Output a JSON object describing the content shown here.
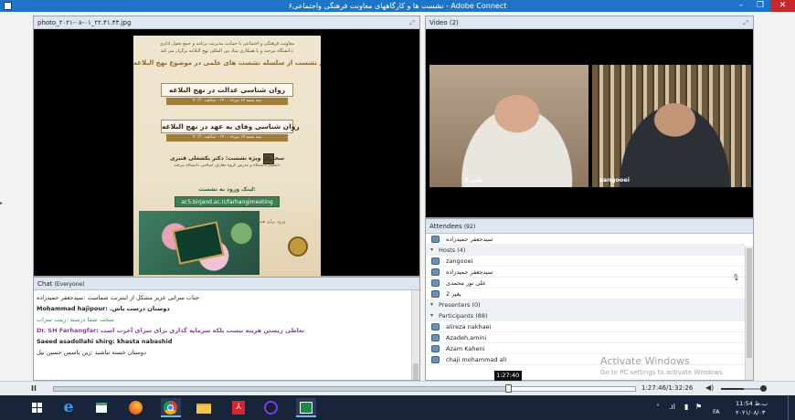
{
  "window": {
    "title": "نشست ها و کارگاههای معاونت فرهنگی واجتماعی۶ - Adobe Connect",
    "controls": {
      "minimize": "–",
      "restore": "❐",
      "close": "✕"
    }
  },
  "photo_pod": {
    "title": "photo_۲۰۲۱-۰۸-۰۱_۲۲.۴۱.۴۳.jpg",
    "poster": {
      "header_1": "معاونت فرهنگی و اجتماعی با حمایت مدیریت برنامه و جمع تحول اداری",
      "header_2": "دانشگاه بیرجند و با همکاری بنیاد بین المللی نهج البلاغه برگزار می کند:",
      "series": "دومین نشست از سلسله نشست های علمی در موضوع نهج البلاغه",
      "talk_1": "روان شناسی عدالت در نهج البلاغه",
      "talk_1_when": "سه شنبه ۱۲ مرداد ۱۴۰۰ - ساعت ۲۰:۳۰",
      "talk_2": "روان شناسی وفای به عهد در نهج البلاغه",
      "talk_2_when": "سه شنبه ۱۹ مرداد ۱۴۰۰ - ساعت ۲۰:۳۰",
      "speaker": "سخنران ویژه نشست: دکتر یکشعلی قنبری",
      "speaker_sub": "دانشیار دانشگاه و مدرس گروه معارف اسلامی دانشگاه بیرجند",
      "link_label": "لینک ورود به نشست:",
      "link": "ac5.birjand.ac.ir/farhangimeeting",
      "link_note": "ورود برای همگان آزاد است"
    }
  },
  "chat_pod": {
    "title": "Chat",
    "scope": "(Everyone)",
    "messages": [
      {
        "text": "جناب سرابی عزیز مشکل از اینترنت شماست :سیدجعفر حمیدزاده",
        "color": "#222222"
      },
      {
        "text": "Mohammad hajipour: .دوستان درست باش",
        "color": "#222222"
      },
      {
        "text": "سخت شما درسته :زینب سراب ",
        "color": "#2f9c4a"
      },
      {
        "text": "Dr. SH Farhangfar: تعاطی زیستن هزینه نیست بلکه سرمایه گذاری برای سرای آخرت است",
        "color": "#8f3aa6"
      },
      {
        "text": "Saeed asadollahi shirg: khasta nabashid",
        "color": "#222222"
      },
      {
        "text": "دوستان خسته نباشید :زین یاسمن حسین نیل",
        "color": "#222222"
      }
    ]
  },
  "video_pod": {
    "title": "Video",
    "count": "(2)",
    "cams": [
      {
        "name": "2 یغیر"
      },
      {
        "name": "zangooei"
      }
    ]
  },
  "attendees_pod": {
    "title": "Attendees",
    "count": "(92)",
    "me": "سیدجعفر حمیدزاده",
    "hosts_label": "Hosts (4)",
    "hosts": [
      "zangooei",
      "سیدجعفر حمیدزاده",
      "علی نور محمدی",
      "2 یغیر"
    ],
    "presenters_label": "Presenters (0)",
    "participants_label": "Participants (88)",
    "participants": [
      "alireza nakhaei",
      "Azadeh.amini",
      "Azam Kaheni",
      "chaji mohammad ali"
    ]
  },
  "watermark": {
    "line1": "Activate Windows",
    "line2": "Go to PC settings to activate Windows."
  },
  "playback": {
    "pause_symbol": "II",
    "progress_fraction": 0.78,
    "tooltip": "1:27:40",
    "time": "1:27:46/1:32:26",
    "volume_fraction": 0.55
  },
  "taskbar": {
    "apps": [
      "windows-start",
      "internet-explorer",
      "store",
      "firefox",
      "chrome",
      "file-explorer",
      "acrobat-reader",
      "firefox-dark",
      "adobe-connect"
    ],
    "tray_lang": "FA",
    "clock_time": "11:54 ب.ظ",
    "clock_date": "۲۰۲۱/۰۸/۰۳"
  }
}
